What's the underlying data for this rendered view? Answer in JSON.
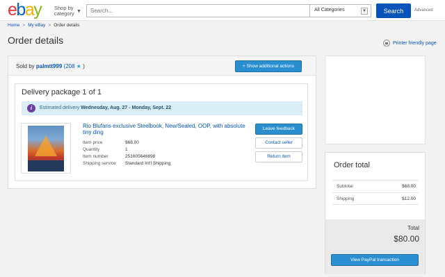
{
  "header": {
    "logo": {
      "e": "e",
      "b": "b",
      "a": "a",
      "y": "y"
    },
    "shop_by": "Shop by category",
    "search_placeholder": "Search...",
    "category": "All Categories",
    "search_button": "Search",
    "advanced": "Advanced"
  },
  "breadcrumb": {
    "home": "Home",
    "my_ebay": "My eBay",
    "current": "Order details",
    "separator": ">"
  },
  "page_title": "Order details",
  "printer_link": "Printer friendly page",
  "seller": {
    "prefix": "Sold by",
    "name": "palmtt999",
    "score": "208",
    "open_paren": "(",
    "close_paren": ")",
    "star": "★",
    "actions_button": "+ Show additional actions"
  },
  "package": {
    "title": "Delivery package 1 of 1",
    "info_icon": "i",
    "estimated_label": "Estimated delivery",
    "estimated_dates": "Wednesday, Aug. 27 - Monday, Sept. 22"
  },
  "item": {
    "title": "Rio Blufans exclusive Steelbook, New/Sealed, OOP, with absolute tiny ding",
    "details": [
      {
        "key": "Item price",
        "value": "$68.00"
      },
      {
        "key": "Quantity",
        "value": "1"
      },
      {
        "key": "Item number",
        "value": "251605646898"
      },
      {
        "key": "Shipping service",
        "value": "Standard Int'l Shipping"
      }
    ],
    "buttons": {
      "leave_feedback": "Leave feedback",
      "contact_seller": "Contact seller",
      "return_item": "Return item"
    }
  },
  "order_total": {
    "title": "Order total",
    "subtotal_label": "Subtotal",
    "subtotal_value": "$68.00",
    "shipping_label": "Shipping",
    "shipping_value": "$12.00",
    "total_label": "Total",
    "total_value": "$80.00",
    "paypal_button": "View PayPal transaction"
  }
}
